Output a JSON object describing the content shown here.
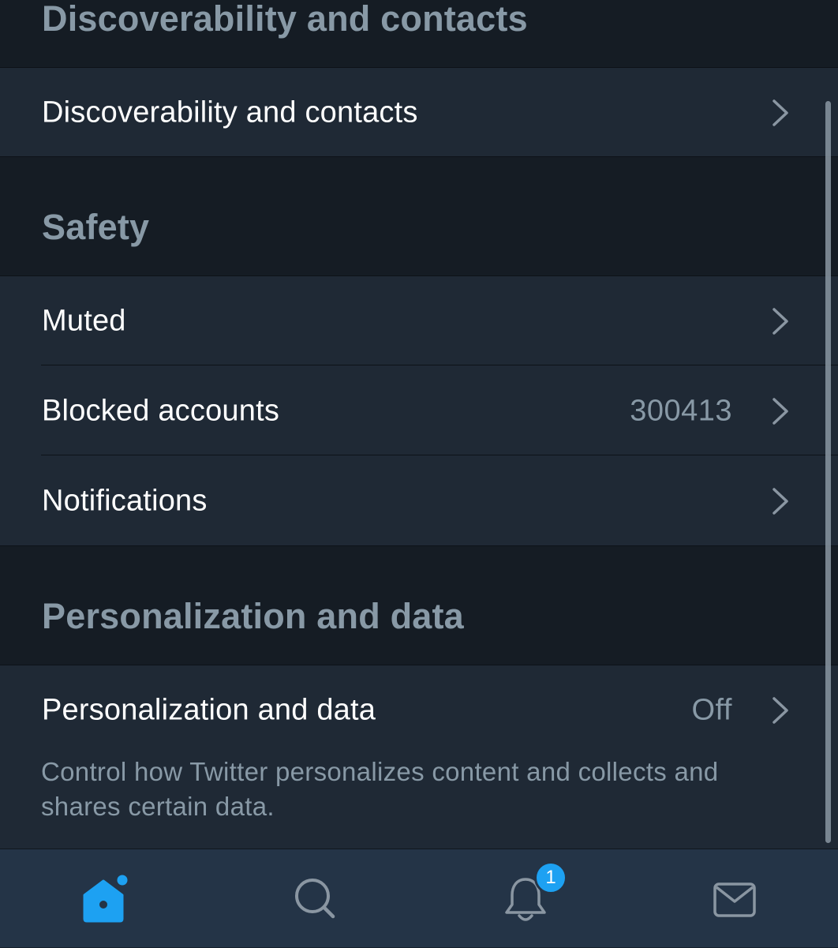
{
  "sections": {
    "discoverability": {
      "title": "Discoverability and contacts",
      "rows": [
        {
          "label": "Discoverability and contacts"
        }
      ]
    },
    "safety": {
      "title": "Safety",
      "rows": [
        {
          "label": "Muted"
        },
        {
          "label": "Blocked accounts",
          "value": "300413"
        },
        {
          "label": "Notifications"
        }
      ]
    },
    "personalization": {
      "title": "Personalization and data",
      "rows": [
        {
          "label": "Personalization and data",
          "value": "Off"
        }
      ],
      "description": "Control how Twitter personalizes content and collects and shares certain data."
    }
  },
  "tabbar": {
    "items": [
      {
        "icon": "home-icon",
        "active": true
      },
      {
        "icon": "search-icon",
        "active": false
      },
      {
        "icon": "bell-icon",
        "active": false,
        "badge": "1"
      },
      {
        "icon": "mail-icon",
        "active": false
      }
    ]
  },
  "colors": {
    "accent": "#1da1f2",
    "background": "#151c24",
    "row_background": "#1f2935",
    "tabbar_background": "#243447",
    "secondary_text": "#8899a6"
  }
}
